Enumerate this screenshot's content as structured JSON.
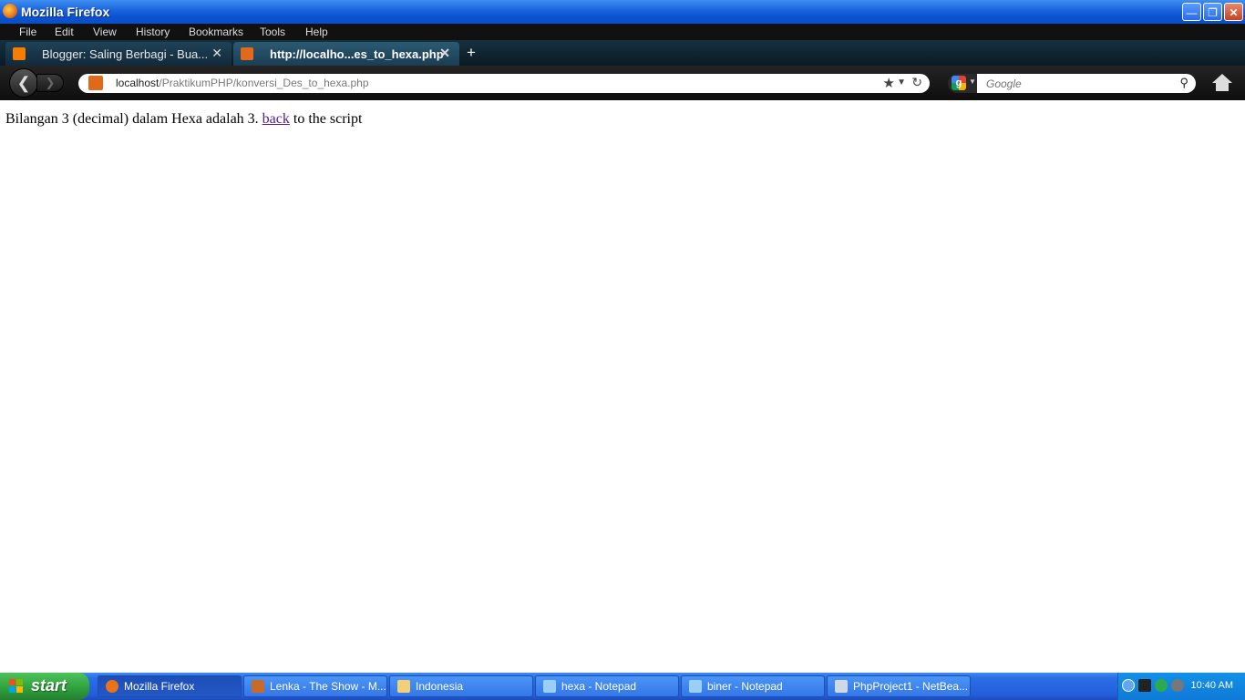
{
  "window": {
    "title": "Mozilla Firefox"
  },
  "menu": [
    "File",
    "Edit",
    "View",
    "History",
    "Bookmarks",
    "Tools",
    "Help"
  ],
  "tabs": [
    {
      "label": "Blogger: Saling Berbagi - Bua...",
      "active": false
    },
    {
      "label": "http://localho...es_to_hexa.php",
      "active": true
    }
  ],
  "new_tab": "+",
  "url": {
    "host": "localhost",
    "path": "/PraktikumPHP/konversi_Des_to_hexa.php"
  },
  "search": {
    "placeholder": "Google"
  },
  "page": {
    "text_before": "Bilangan 3 (decimal) dalam Hexa adalah 3. ",
    "link": "back",
    "text_after": " to the script"
  },
  "taskbar": {
    "start": "start",
    "tasks": [
      {
        "label": "Mozilla Firefox",
        "active": true
      },
      {
        "label": "Lenka - The Show - M...",
        "active": false
      },
      {
        "label": "Indonesia",
        "active": false
      },
      {
        "label": "hexa - Notepad",
        "active": false
      },
      {
        "label": "biner - Notepad",
        "active": false
      },
      {
        "label": "PhpProject1 - NetBea...",
        "active": false
      }
    ],
    "clock": "10:40 AM"
  },
  "colors": {
    "link": "#551a8b",
    "titlebar": "#0b52d0",
    "start": "#2e9e3c"
  }
}
